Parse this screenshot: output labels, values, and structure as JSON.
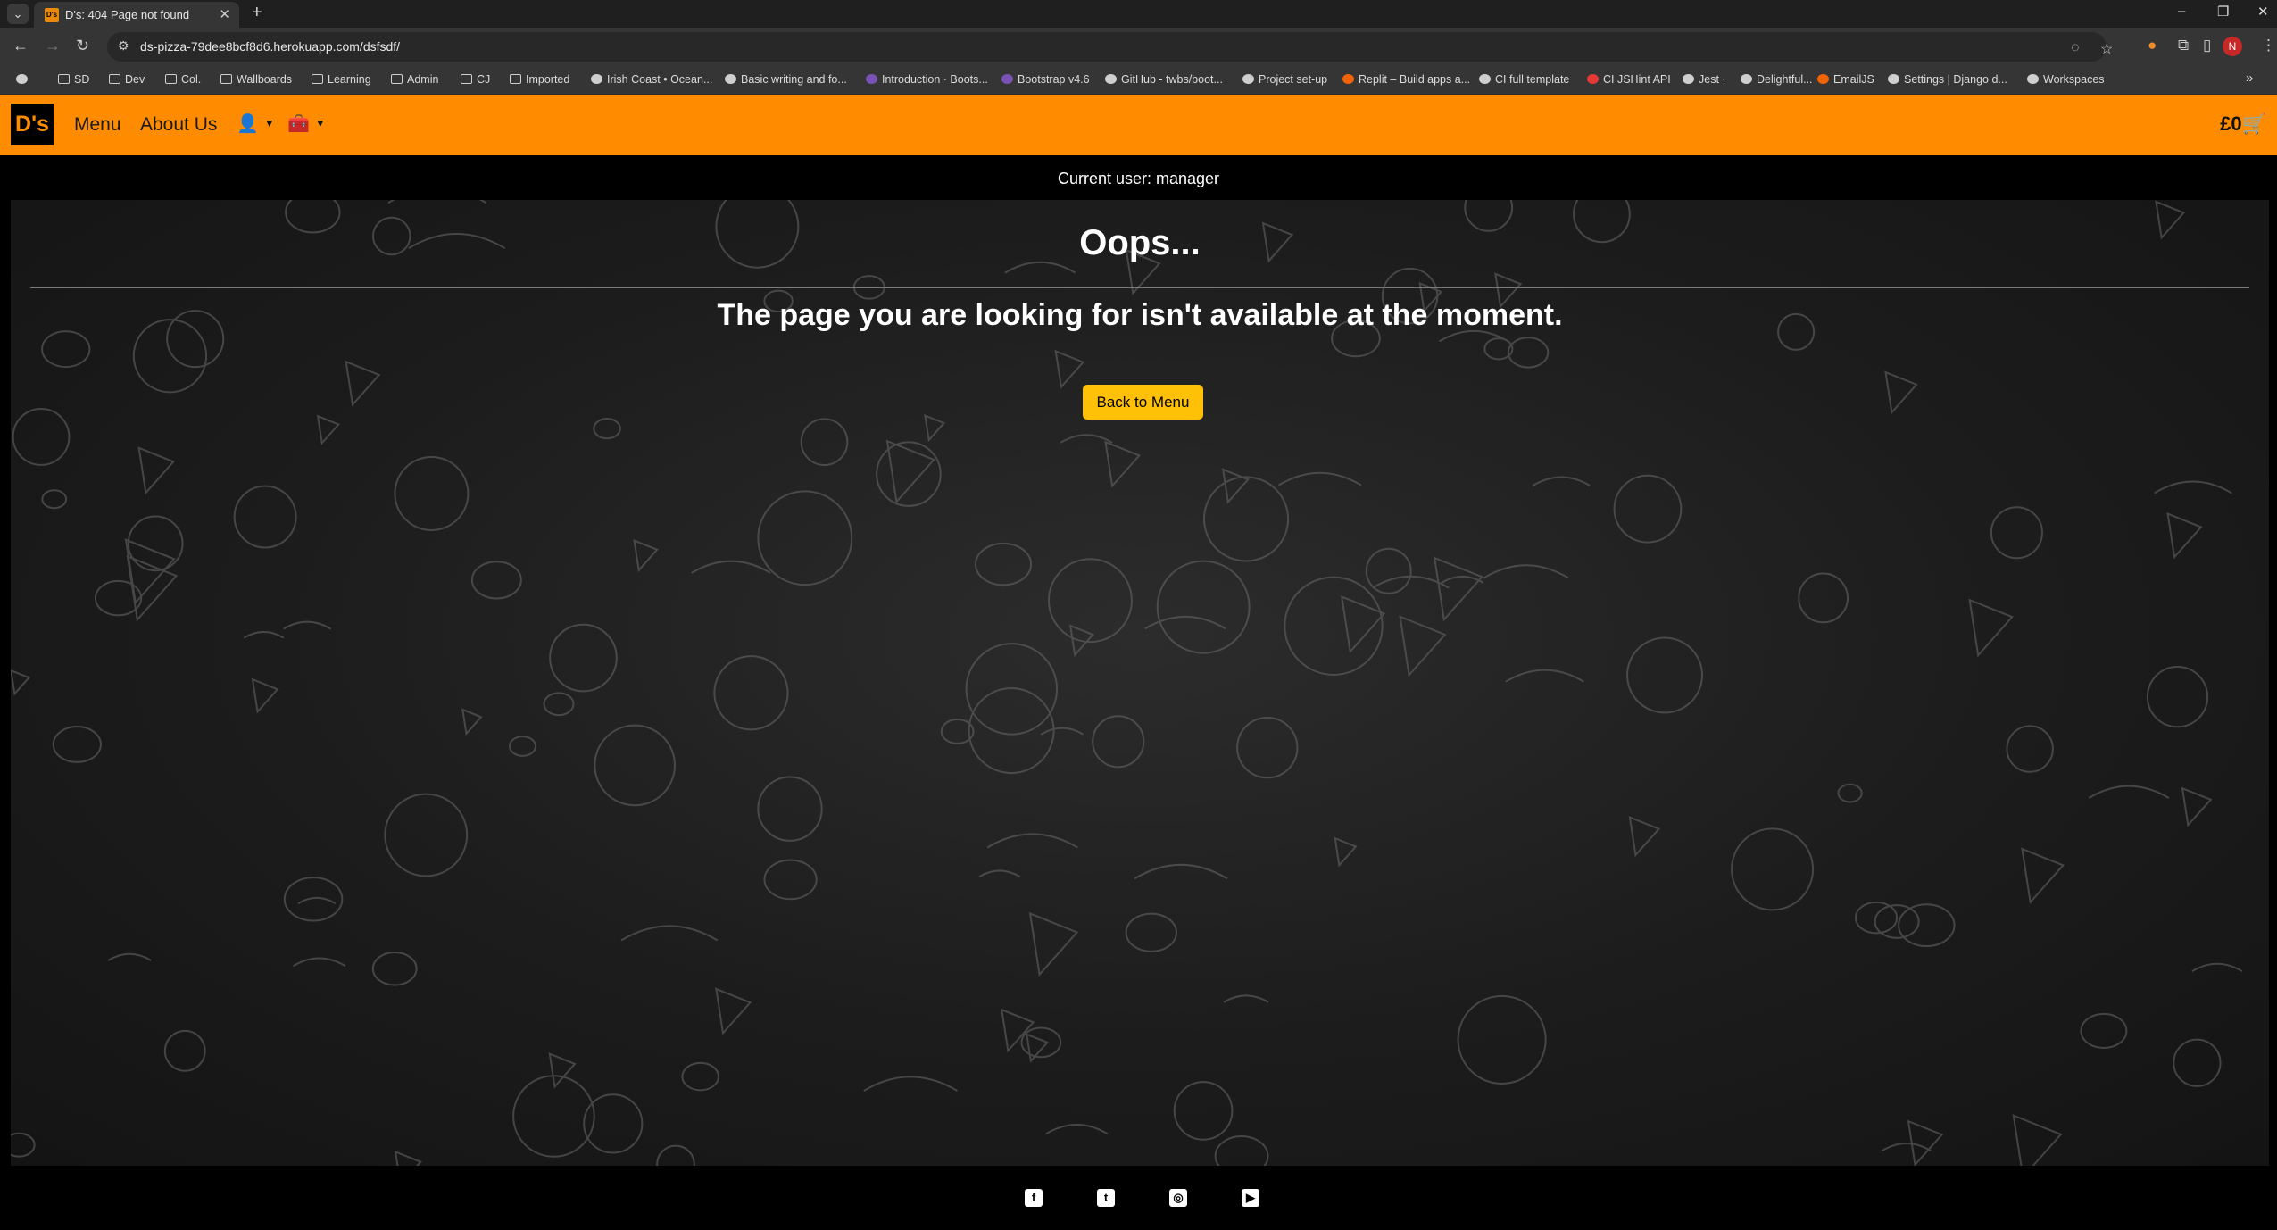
{
  "browser": {
    "tab_list_icon": "chevron-down-icon",
    "tab": {
      "title": "D's: 404 Page not found",
      "close": "✕",
      "favicon": "D's"
    },
    "new_tab": "+",
    "window_controls": {
      "minimize": "–",
      "restore": "❐",
      "close": "✕"
    },
    "nav": {
      "back": "←",
      "forward": "→",
      "reload": "↻"
    },
    "url": "ds-pizza-79dee8bcf8d6.herokuapp.com/dsfsdf/",
    "profile_initial": "N",
    "bookmarks": [
      {
        "label": "",
        "icon": "apps-icon"
      },
      {
        "label": "SD",
        "icon": "folder-icon"
      },
      {
        "label": "Dev",
        "icon": "folder-icon"
      },
      {
        "label": "Col.",
        "icon": "folder-icon"
      },
      {
        "label": "Wallboards",
        "icon": "folder-icon"
      },
      {
        "label": "Learning",
        "icon": "folder-icon"
      },
      {
        "label": "Admin",
        "icon": "folder-icon"
      },
      {
        "label": "CJ",
        "icon": "folder-icon"
      },
      {
        "label": "Imported",
        "icon": "folder-icon"
      },
      {
        "label": "Irish Coast • Ocean...",
        "icon": "globe-icon"
      },
      {
        "label": "Basic writing and fo...",
        "icon": "github-icon"
      },
      {
        "label": "Introduction · Boots...",
        "icon": "bootstrap-icon"
      },
      {
        "label": "Bootstrap v4.6",
        "icon": "bootstrap-icon"
      },
      {
        "label": "GitHub - twbs/boot...",
        "icon": "github-icon"
      },
      {
        "label": "Project set-up",
        "icon": "globe-icon"
      },
      {
        "label": "Replit – Build apps a...",
        "icon": "replit-icon"
      },
      {
        "label": "CI full template",
        "icon": "github-icon"
      },
      {
        "label": "CI JSHint API",
        "icon": "jshint-icon"
      },
      {
        "label": "Jest ·",
        "icon": "jest-icon"
      },
      {
        "label": "Delightful...",
        "icon": "doc-icon"
      },
      {
        "label": "EmailJS",
        "icon": "emailjs-icon"
      },
      {
        "label": "Settings | Django d...",
        "icon": "django-icon"
      },
      {
        "label": "Workspaces",
        "icon": "workspaces-icon"
      }
    ],
    "bookmarks_overflow": "»"
  },
  "site": {
    "logo": "D's",
    "nav": {
      "menu": "Menu",
      "about": "About Us",
      "account_icon": "👤",
      "manage_icon": "🧰",
      "caret": "▼"
    },
    "basket": "£0",
    "basket_icon": "🛒",
    "current_user": "Current user: manager",
    "heading": "Oops...",
    "message": "The page you are looking for isn't available at the moment.",
    "back_button": "Back to Menu",
    "social": [
      {
        "name": "facebook",
        "glyph": "f"
      },
      {
        "name": "twitter",
        "glyph": "t"
      },
      {
        "name": "instagram",
        "glyph": "◎"
      },
      {
        "name": "youtube",
        "glyph": "▶"
      }
    ]
  },
  "colors": {
    "nav_orange": "#ff8c00",
    "button_yellow": "#ffc107",
    "background_dark": "#1c1c1c",
    "browser_chrome": "#353535"
  }
}
